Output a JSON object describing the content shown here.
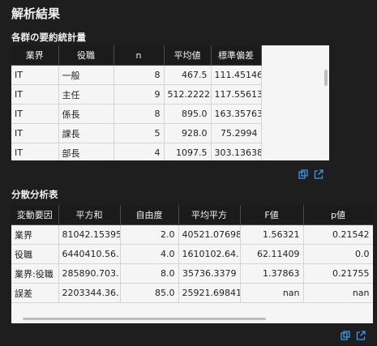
{
  "title": "解析結果",
  "summary": {
    "heading": "各群の要約統計量",
    "columns": [
      "業界",
      "役職",
      "n",
      "平均値",
      "標準偏差"
    ],
    "rows": [
      [
        "IT",
        "一般",
        "8",
        "467.5",
        "111.45146"
      ],
      [
        "IT",
        "主任",
        "9",
        "512.22222",
        "117.55613"
      ],
      [
        "IT",
        "係長",
        "8",
        "895.0",
        "163.35763"
      ],
      [
        "IT",
        "課長",
        "5",
        "928.0",
        "75.2994"
      ],
      [
        "IT",
        "部長",
        "4",
        "1097.5",
        "303.13638"
      ]
    ]
  },
  "anova": {
    "heading": "分散分析表",
    "columns": [
      "変動要因",
      "平方和",
      "自由度",
      "平均平方",
      "F値",
      "p値"
    ],
    "rows": [
      [
        "業界",
        "81042.15395",
        "2.0",
        "40521.07698",
        "1.56321",
        "0.21542"
      ],
      [
        "役職",
        "6440410.56…",
        "4.0",
        "1610102.64…",
        "62.11409",
        "0.0"
      ],
      [
        "業界:役職",
        "285890.703…",
        "8.0",
        "35736.3379",
        "1.37863",
        "0.21755"
      ],
      [
        "誤差",
        "2203344.36…",
        "85.0",
        "25921.69841",
        "nan",
        "nan"
      ]
    ]
  },
  "icons": {
    "copy": "copy-icon",
    "open": "open-external-icon",
    "accent": "#3a9ae8"
  }
}
